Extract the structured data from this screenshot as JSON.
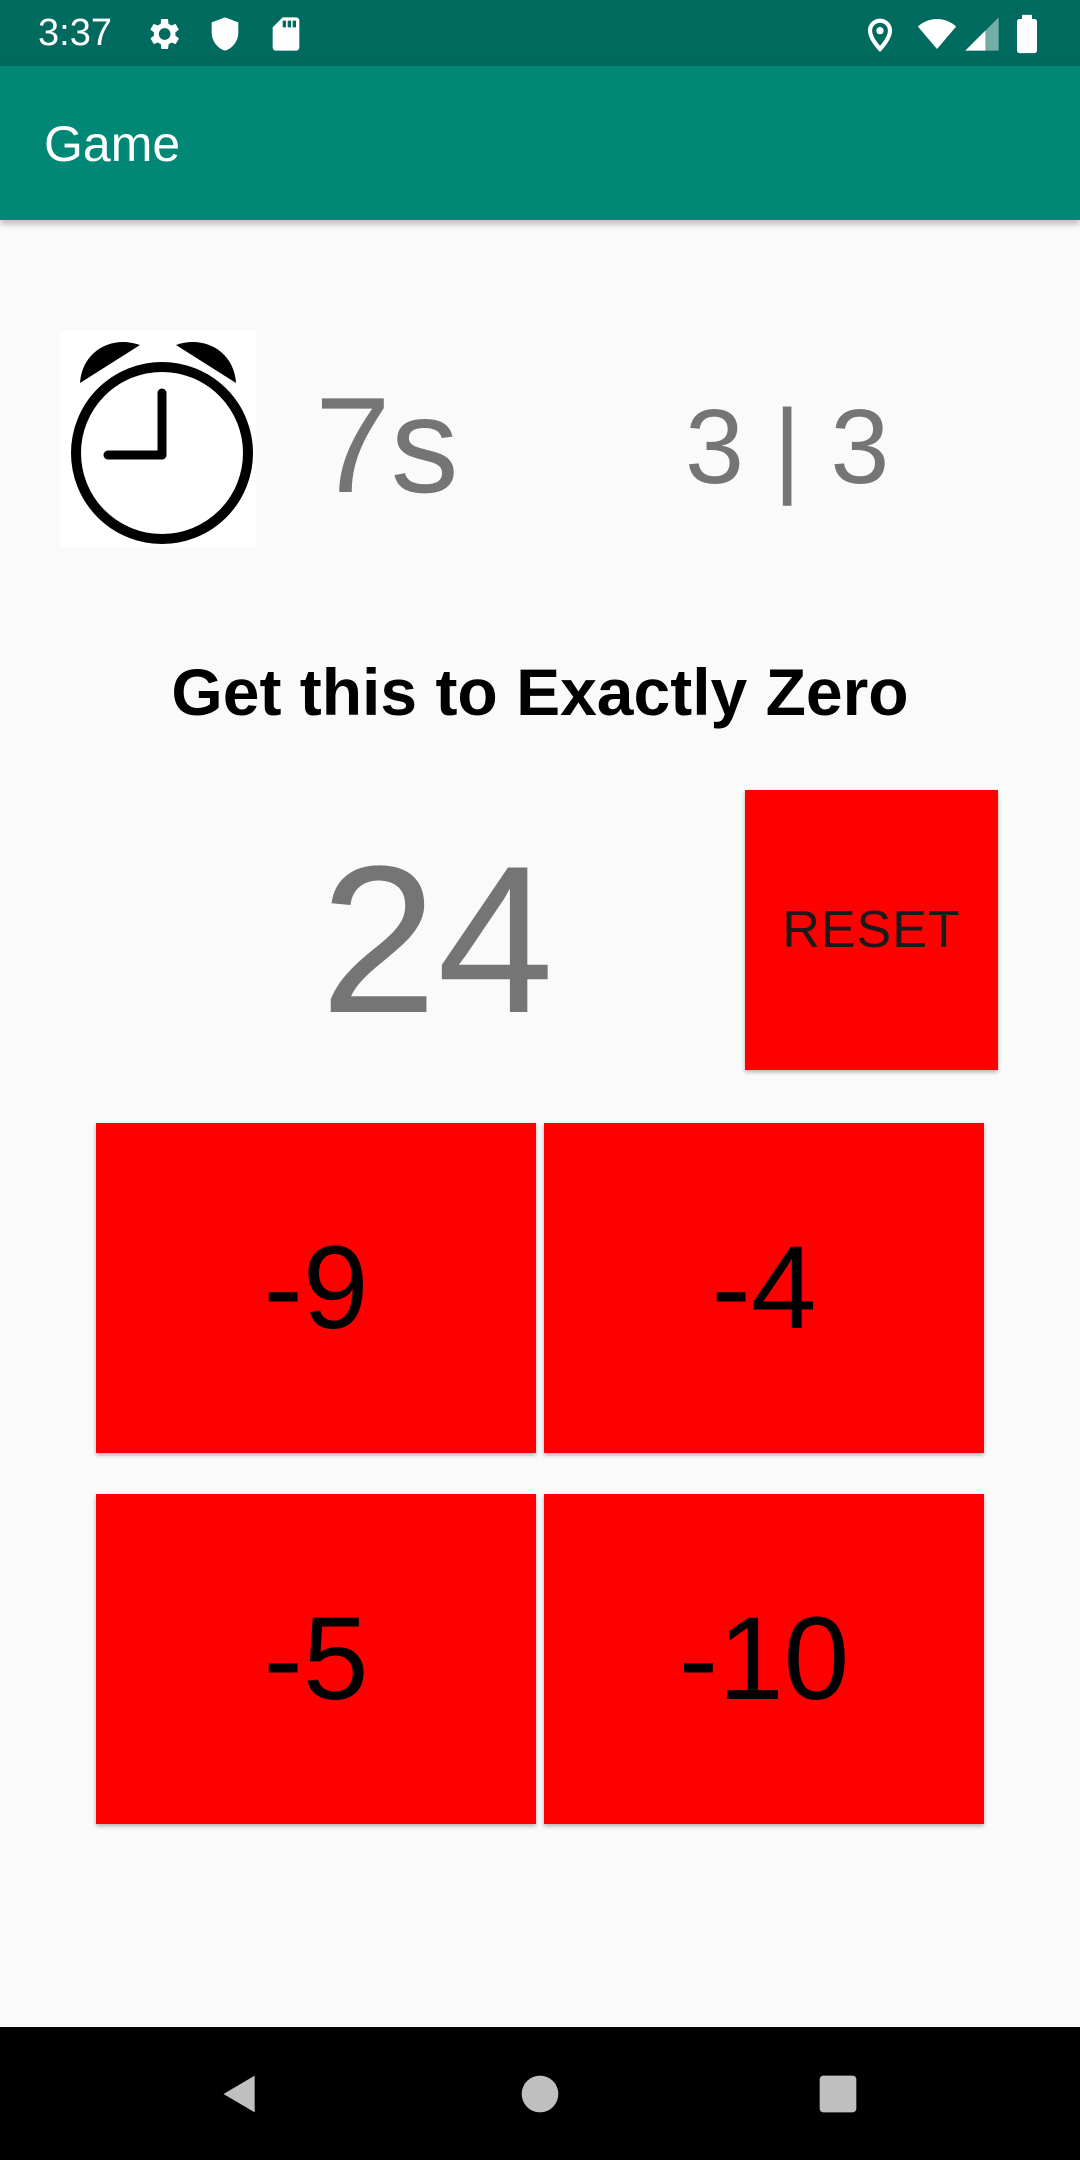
{
  "status_bar": {
    "time": "3:37",
    "left_icons": [
      "gear-icon",
      "shield-icon",
      "sd-card-icon"
    ],
    "right_icons": [
      "location-icon",
      "wifi-icon",
      "signal-icon",
      "battery-icon"
    ]
  },
  "app_bar": {
    "title": "Game"
  },
  "game": {
    "timer": "7s",
    "score": "3 | 3",
    "instruction": "Get this to Exactly Zero",
    "target": "24",
    "reset_label": "RESET",
    "buttons": [
      "-9",
      "-4",
      "-5",
      "-10"
    ]
  },
  "nav_bar": {
    "icons": [
      "back-icon",
      "home-icon",
      "recents-icon"
    ]
  },
  "colors": {
    "status_bar": "#016a5e",
    "app_bar": "#018776",
    "button": "#ff0000",
    "number_gray": "#757575"
  }
}
